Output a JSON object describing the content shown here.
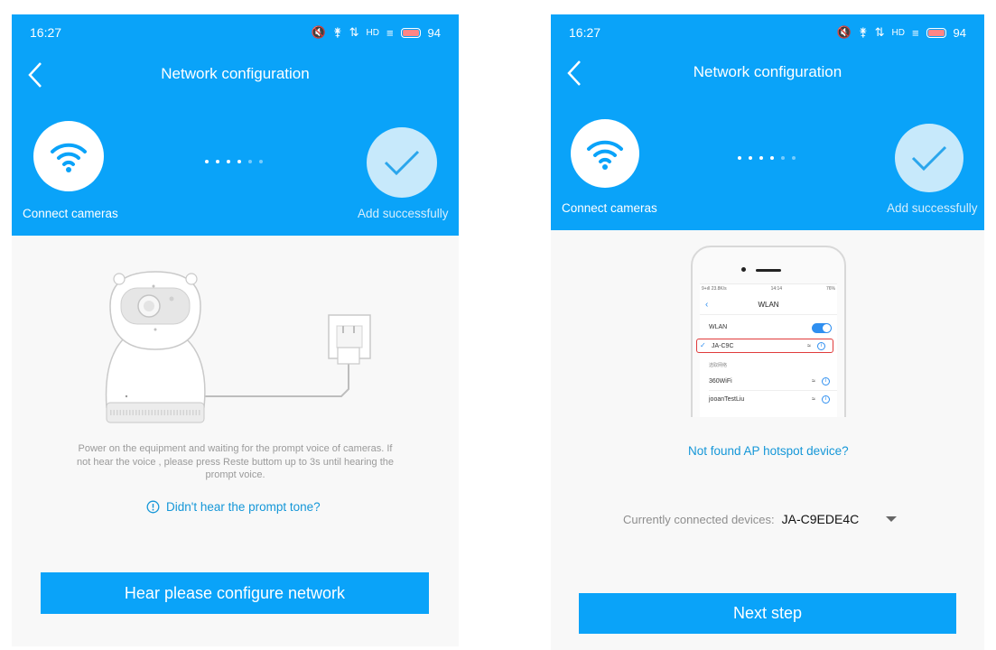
{
  "status_bar": {
    "time": "16:27",
    "battery": "94",
    "icons": [
      "mute-icon",
      "lock-icon",
      "network-speed-icon",
      "hd-icon",
      "signal-icon",
      "battery-icon"
    ]
  },
  "nav": {
    "title": "Network configuration"
  },
  "steps": {
    "connect_label": "Connect cameras",
    "success_label": "Add successfully"
  },
  "colors": {
    "accent": "#0aa3f9",
    "link": "#1597d8",
    "background": "#f8f8f8"
  },
  "left_screen": {
    "illustration": "camera-plugged-into-socket",
    "hint": "Power on the equipment and waiting for the prompt voice of cameras. If not hear the voice , please press Reste buttom up to 3s until hearing the prompt voice.",
    "help_link": "Didn't hear the prompt tone?",
    "button": "Hear please configure network"
  },
  "right_screen": {
    "phone_mock": {
      "status_left": "9+ıll 23.8K/s",
      "status_time": "14:14",
      "status_right": "76%",
      "title": "WLAN",
      "wlan_label": "WLAN",
      "selected_network": "JA-C9C",
      "section_label": "选取网络",
      "networks": [
        "360WiFi",
        "jooanTestLiu"
      ]
    },
    "help_link": "Not found AP hotspot device?",
    "device_label": "Currently connected devices:",
    "device_value": "JA-C9EDE4C",
    "button": "Next step"
  }
}
